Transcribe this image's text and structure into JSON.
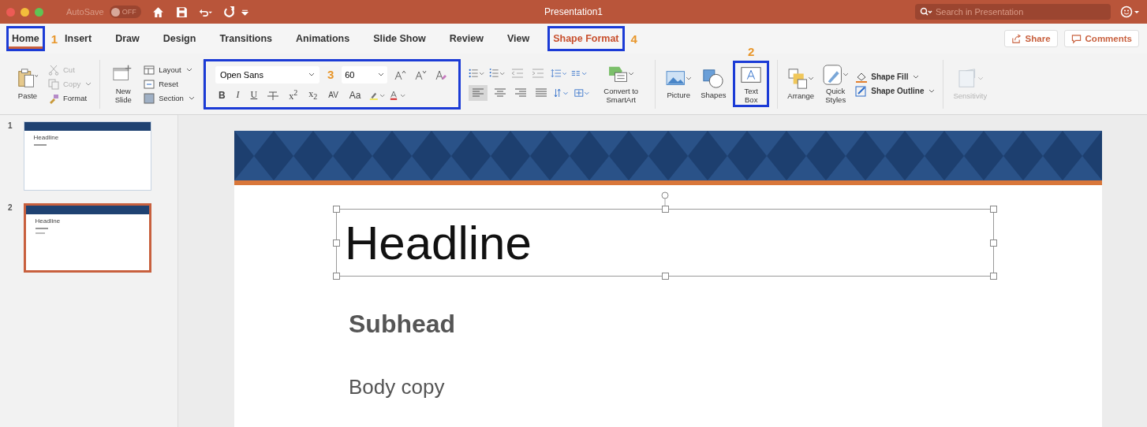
{
  "window": {
    "title": "Presentation1"
  },
  "titlebar": {
    "autosave": "AutoSave",
    "autosave_on": false,
    "autosave_state": "OFF",
    "search": {
      "placeholder": "Search in Presentation"
    }
  },
  "tabs": [
    {
      "label": "Home",
      "selected": true,
      "kind": "normal",
      "boxed": true,
      "callout": "1"
    },
    {
      "label": "Insert",
      "selected": false,
      "kind": "normal",
      "boxed": false
    },
    {
      "label": "Draw",
      "selected": false,
      "kind": "normal",
      "boxed": false
    },
    {
      "label": "Design",
      "selected": false,
      "kind": "normal",
      "boxed": false
    },
    {
      "label": "Transitions",
      "selected": false,
      "kind": "normal",
      "boxed": false
    },
    {
      "label": "Animations",
      "selected": false,
      "kind": "normal",
      "boxed": false
    },
    {
      "label": "Slide Show",
      "selected": false,
      "kind": "normal",
      "boxed": false
    },
    {
      "label": "Review",
      "selected": false,
      "kind": "normal",
      "boxed": false
    },
    {
      "label": "View",
      "selected": false,
      "kind": "normal",
      "boxed": false
    },
    {
      "label": "Shape Format",
      "selected": false,
      "kind": "contextual",
      "boxed": true,
      "callout": "4"
    }
  ],
  "share": "Share",
  "comments": "Comments",
  "clipboard": {
    "paste": "Paste",
    "cut": {
      "label": "Cut",
      "disabled": true
    },
    "copy": {
      "label": "Copy",
      "disabled": true
    },
    "format": {
      "label": "Format",
      "disabled": false
    }
  },
  "slides": {
    "new_slide": "New Slide",
    "layout": "Layout",
    "reset": "Reset",
    "section": "Section"
  },
  "font": {
    "boxed": true,
    "callout": "3",
    "name": "Open Sans",
    "size": "60",
    "styles": [
      {
        "kind": "bold",
        "label": "B"
      },
      {
        "kind": "italic",
        "label": "I"
      },
      {
        "kind": "underline",
        "label": "U"
      },
      {
        "kind": "super",
        "label": "x$^{2}$"
      },
      {
        "kind": "sub",
        "label": "x$_{2}$"
      },
      {
        "kind": "spacing",
        "label": "AV"
      },
      {
        "kind": "case",
        "label": "Aa"
      }
    ]
  },
  "paragraph": {
    "smartart": "Convert to SmartArt"
  },
  "insert": [
    {
      "kind": "picture",
      "label": "Picture",
      "boxed": false
    },
    {
      "kind": "shapes",
      "label": "Shapes",
      "boxed": false
    },
    {
      "kind": "textbox",
      "label": "Text Box",
      "boxed": true,
      "callout": "2"
    }
  ],
  "drawing": {
    "arrange": "Arrange",
    "quick_styles": "Quick Styles",
    "shape_fill": "Shape Fill",
    "shape_outline": "Shape Outline"
  },
  "sensitivity": {
    "label": "Sensitivity",
    "disabled": true
  },
  "thumbnails": [
    {
      "number": "1",
      "selected": false,
      "headline": "Headline"
    },
    {
      "number": "2",
      "selected": true,
      "headline": "Headline"
    }
  ],
  "slide": {
    "headline": "Headline",
    "headline_selected": true,
    "subhead": "Subhead",
    "body": "Body copy"
  }
}
